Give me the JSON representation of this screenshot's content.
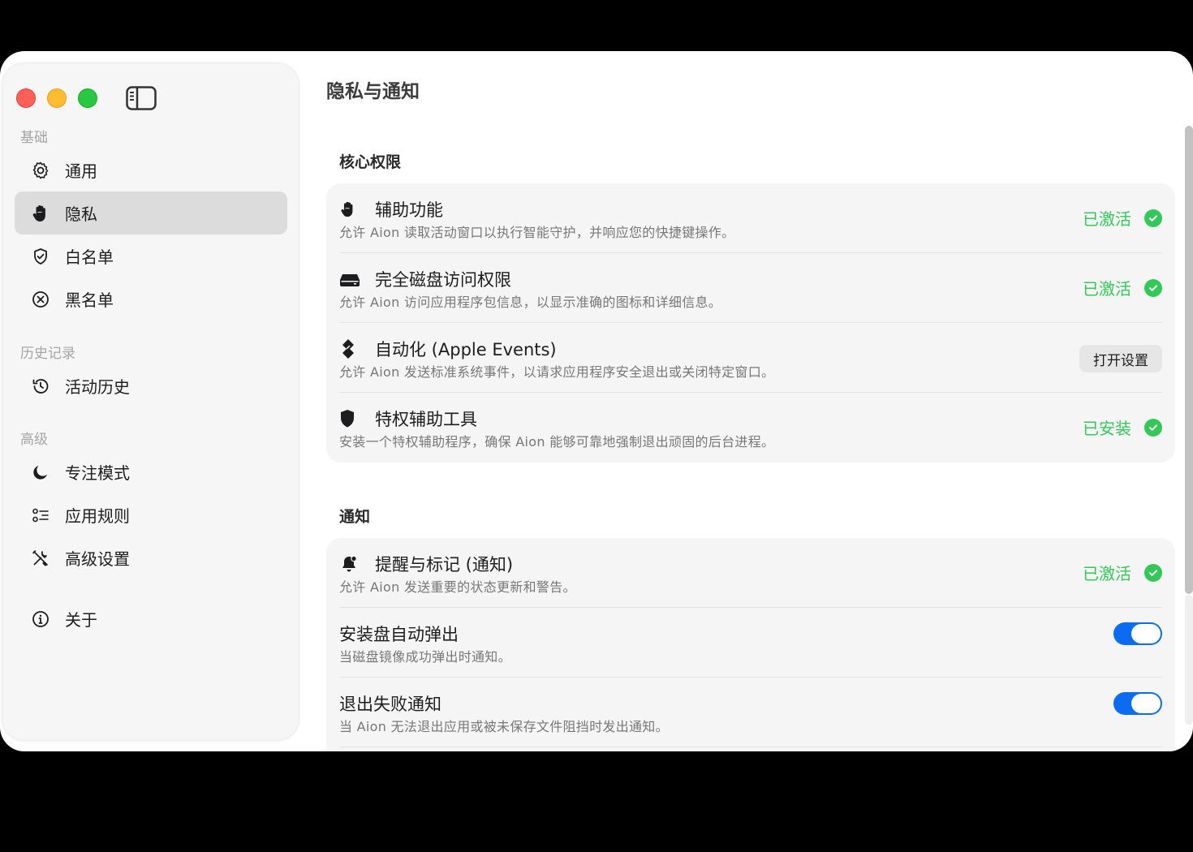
{
  "sidebar": {
    "sections": {
      "basic": "基础",
      "history": "历史记录",
      "advanced": "高级"
    },
    "items": [
      {
        "label": "通用",
        "icon": "gear-icon"
      },
      {
        "label": "隐私",
        "icon": "hand-icon",
        "selected": true
      },
      {
        "label": "白名单",
        "icon": "shield-check-icon"
      },
      {
        "label": "黑名单",
        "icon": "circle-x-icon"
      },
      {
        "label": "活动历史",
        "icon": "history-icon"
      },
      {
        "label": "专注模式",
        "icon": "moon-icon"
      },
      {
        "label": "应用规则",
        "icon": "list-checks-icon"
      },
      {
        "label": "高级设置",
        "icon": "tools-icon"
      },
      {
        "label": "关于",
        "icon": "info-icon"
      }
    ]
  },
  "main": {
    "title": "隐私与通知",
    "core": {
      "title": "核心权限",
      "rows": [
        {
          "title": "辅助功能",
          "desc": "允许 Aion 读取活动窗口以执行智能守护，并响应您的快捷键操作。",
          "status": "已激活"
        },
        {
          "title": "完全磁盘访问权限",
          "desc": "允许 Aion 访问应用程序包信息，以显示准确的图标和详细信息。",
          "status": "已激活"
        },
        {
          "title": "自动化 (Apple Events)",
          "desc": "允许 Aion 发送标准系统事件，以请求应用程序安全退出或关闭特定窗口。",
          "button": "打开设置"
        },
        {
          "title": "特权辅助工具",
          "desc": "安装一个特权辅助程序，确保 Aion 能够可靠地强制退出顽固的后台进程。",
          "status": "已安装"
        }
      ]
    },
    "notify": {
      "title": "通知",
      "rows": [
        {
          "title": "提醒与标记 (通知)",
          "desc": "允许 Aion 发送重要的状态更新和警告。",
          "status": "已激活"
        },
        {
          "title": "安装盘自动弹出",
          "desc": "当磁盘镜像成功弹出时通知。",
          "toggle": true
        },
        {
          "title": "退出失败通知",
          "desc": "当 Aion 无法退出应用或被未保存文件阻挡时发出通知。",
          "toggle": true
        }
      ]
    }
  },
  "colors": {
    "accent": "#0a6cf0",
    "success": "#34c759",
    "selected_bg": "#dcdcdc"
  }
}
